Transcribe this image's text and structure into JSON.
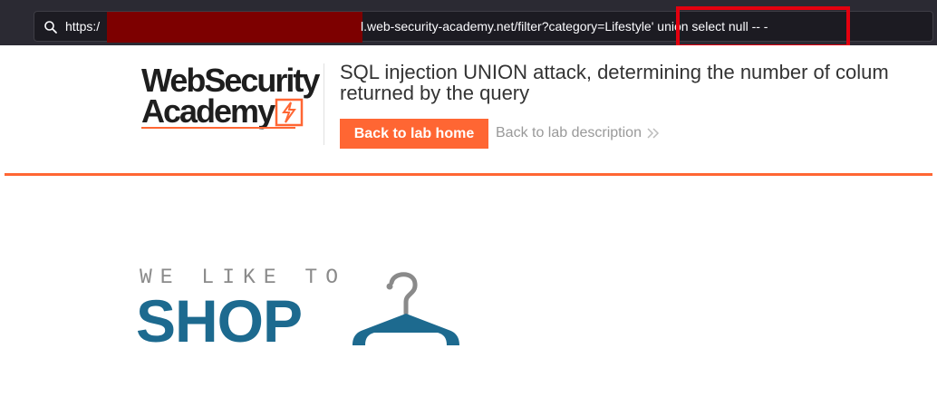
{
  "browser": {
    "url_prefix": "https:/",
    "url_rest": "l.web-security-academy.net/filter?category=Lifestyle' union select null -- -"
  },
  "lab_header": {
    "logo_line1": "WebSecurity",
    "logo_line2": "Academy",
    "title_line1": "SQL injection UNION attack, determining the number of colum",
    "title_line2": "returned by the query",
    "back_button_label": "Back to lab home",
    "back_description_label": "Back to lab description"
  },
  "shop": {
    "tagline": "WE LIKE TO",
    "name": "SHOP"
  },
  "colors": {
    "accent": "#ff6633",
    "shop_blue": "#1d6a8f",
    "highlight": "#e3000f",
    "redaction": "#7d0000"
  }
}
